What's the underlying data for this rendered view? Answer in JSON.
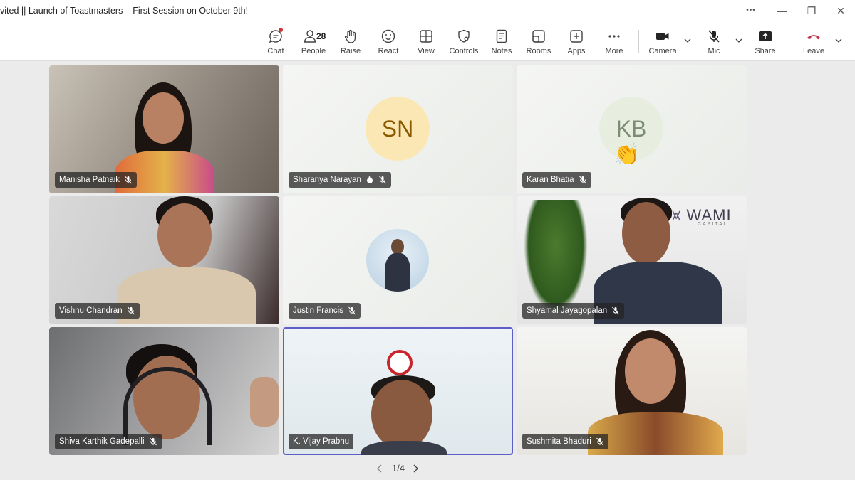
{
  "window": {
    "title": "vited || Launch of Toastmasters – First Session on October 9th!",
    "more_glyph": "•••",
    "minimize_glyph": "—",
    "restore_glyph": "❐",
    "close_glyph": "✕"
  },
  "toolbar": {
    "chat_label": "Chat",
    "people_label": "People",
    "people_count": "28",
    "raise_label": "Raise",
    "react_label": "React",
    "view_label": "View",
    "controls_label": "Controls",
    "notes_label": "Notes",
    "rooms_label": "Rooms",
    "apps_label": "Apps",
    "more_label": "More",
    "camera_label": "Camera",
    "mic_label": "Mic",
    "share_label": "Share",
    "leave_label": "Leave",
    "leave_color": "#c4314b"
  },
  "participants": [
    {
      "name": "Manisha Patnaik",
      "muted": true
    },
    {
      "name": "Sharanya Narayan",
      "muted": true,
      "initials": "SN",
      "avatar_bg": "#fbe7b4",
      "avatar_fg": "#8a5a00"
    },
    {
      "name": "Karan Bhatia",
      "muted": true,
      "initials": "KB",
      "avatar_bg": "#e7eee0",
      "avatar_fg": "#7d8a74",
      "reaction": "👏"
    },
    {
      "name": "Vishnu Chandran",
      "muted": true
    },
    {
      "name": "Justin Francis",
      "muted": true
    },
    {
      "name": "Shyamal Jayagopalan",
      "muted": true,
      "backdrop_text": "WAMI",
      "backdrop_subtext": "CAPITAL"
    },
    {
      "name": "Shiva Karthik Gadepalli",
      "muted": true
    },
    {
      "name": "K. Vijay Prabhu",
      "muted": false
    },
    {
      "name": "Sushmita Bhaduri",
      "muted": true
    }
  ],
  "pager": {
    "label": "1/4"
  },
  "colors": {
    "accent": "#5b5fc7",
    "app_bg": "#ebebeb"
  }
}
